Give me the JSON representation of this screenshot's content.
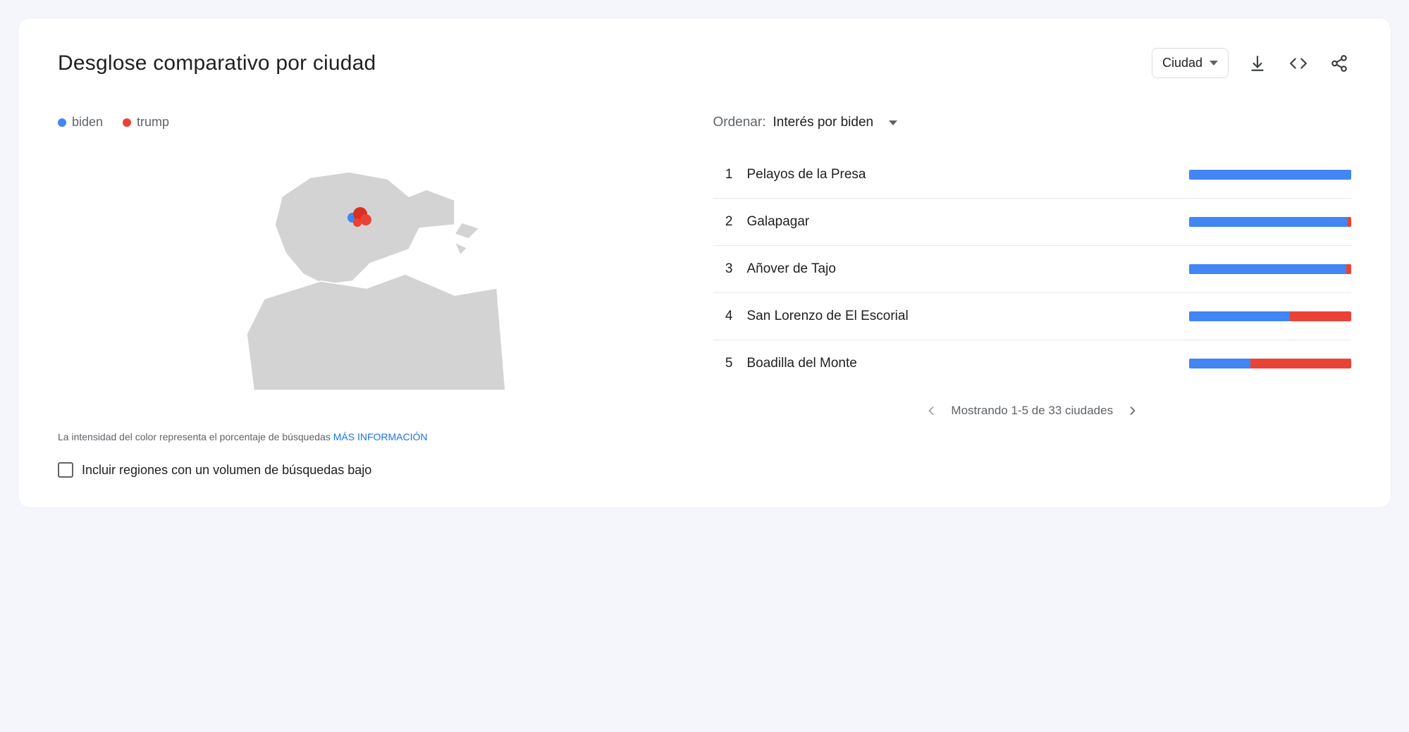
{
  "colors": {
    "blue": "#4285f4",
    "red": "#ea4335"
  },
  "header": {
    "title": "Desglose comparativo por ciudad",
    "scope_label": "Ciudad"
  },
  "legend": {
    "items": [
      {
        "label": "biden",
        "color": "blue"
      },
      {
        "label": "trump",
        "color": "red"
      }
    ]
  },
  "sort": {
    "label": "Ordenar:",
    "value": "Interés por biden"
  },
  "chart_data": {
    "type": "bar",
    "title": "Desglose comparativo por ciudad",
    "xlabel": "",
    "ylabel": "",
    "categories": [
      "Pelayos de la Presa",
      "Galapagar",
      "Añover de Tajo",
      "San Lorenzo de El Escorial",
      "Boadilla del Monte"
    ],
    "series": [
      {
        "name": "biden",
        "values": [
          100,
          98,
          97,
          62,
          38
        ]
      },
      {
        "name": "trump",
        "values": [
          0,
          2,
          3,
          38,
          62
        ]
      }
    ],
    "ylim": [
      0,
      100
    ]
  },
  "cities": [
    {
      "rank": "1",
      "name": "Pelayos de la Presa",
      "blue_pct": 100,
      "red_pct": 0
    },
    {
      "rank": "2",
      "name": "Galapagar",
      "blue_pct": 98,
      "red_pct": 2
    },
    {
      "rank": "3",
      "name": "Añover de Tajo",
      "blue_pct": 97,
      "red_pct": 3
    },
    {
      "rank": "4",
      "name": "San Lorenzo de El Escorial",
      "blue_pct": 62,
      "red_pct": 38
    },
    {
      "rank": "5",
      "name": "Boadilla del Monte",
      "blue_pct": 38,
      "red_pct": 62
    }
  ],
  "pager": {
    "text": "Mostrando 1-5 de 33 ciudades"
  },
  "footnote": {
    "text": "La intensidad del color representa el porcentaje de búsquedas ",
    "link_label": "MÁS INFORMACIÓN"
  },
  "checkbox_label": "Incluir regiones con un volumen de búsquedas bajo"
}
